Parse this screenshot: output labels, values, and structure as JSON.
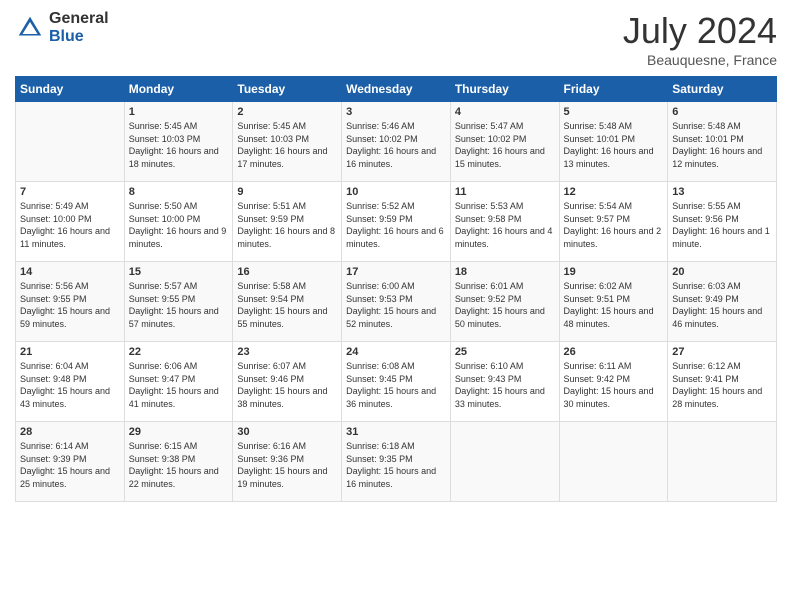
{
  "header": {
    "logo_general": "General",
    "logo_blue": "Blue",
    "month": "July 2024",
    "location": "Beauquesne, France"
  },
  "days_of_week": [
    "Sunday",
    "Monday",
    "Tuesday",
    "Wednesday",
    "Thursday",
    "Friday",
    "Saturday"
  ],
  "weeks": [
    [
      {
        "day": "",
        "sunrise": "",
        "sunset": "",
        "daylight": ""
      },
      {
        "day": "1",
        "sunrise": "Sunrise: 5:45 AM",
        "sunset": "Sunset: 10:03 PM",
        "daylight": "Daylight: 16 hours and 18 minutes."
      },
      {
        "day": "2",
        "sunrise": "Sunrise: 5:45 AM",
        "sunset": "Sunset: 10:03 PM",
        "daylight": "Daylight: 16 hours and 17 minutes."
      },
      {
        "day": "3",
        "sunrise": "Sunrise: 5:46 AM",
        "sunset": "Sunset: 10:02 PM",
        "daylight": "Daylight: 16 hours and 16 minutes."
      },
      {
        "day": "4",
        "sunrise": "Sunrise: 5:47 AM",
        "sunset": "Sunset: 10:02 PM",
        "daylight": "Daylight: 16 hours and 15 minutes."
      },
      {
        "day": "5",
        "sunrise": "Sunrise: 5:48 AM",
        "sunset": "Sunset: 10:01 PM",
        "daylight": "Daylight: 16 hours and 13 minutes."
      },
      {
        "day": "6",
        "sunrise": "Sunrise: 5:48 AM",
        "sunset": "Sunset: 10:01 PM",
        "daylight": "Daylight: 16 hours and 12 minutes."
      }
    ],
    [
      {
        "day": "7",
        "sunrise": "Sunrise: 5:49 AM",
        "sunset": "Sunset: 10:00 PM",
        "daylight": "Daylight: 16 hours and 11 minutes."
      },
      {
        "day": "8",
        "sunrise": "Sunrise: 5:50 AM",
        "sunset": "Sunset: 10:00 PM",
        "daylight": "Daylight: 16 hours and 9 minutes."
      },
      {
        "day": "9",
        "sunrise": "Sunrise: 5:51 AM",
        "sunset": "Sunset: 9:59 PM",
        "daylight": "Daylight: 16 hours and 8 minutes."
      },
      {
        "day": "10",
        "sunrise": "Sunrise: 5:52 AM",
        "sunset": "Sunset: 9:59 PM",
        "daylight": "Daylight: 16 hours and 6 minutes."
      },
      {
        "day": "11",
        "sunrise": "Sunrise: 5:53 AM",
        "sunset": "Sunset: 9:58 PM",
        "daylight": "Daylight: 16 hours and 4 minutes."
      },
      {
        "day": "12",
        "sunrise": "Sunrise: 5:54 AM",
        "sunset": "Sunset: 9:57 PM",
        "daylight": "Daylight: 16 hours and 2 minutes."
      },
      {
        "day": "13",
        "sunrise": "Sunrise: 5:55 AM",
        "sunset": "Sunset: 9:56 PM",
        "daylight": "Daylight: 16 hours and 1 minute."
      }
    ],
    [
      {
        "day": "14",
        "sunrise": "Sunrise: 5:56 AM",
        "sunset": "Sunset: 9:55 PM",
        "daylight": "Daylight: 15 hours and 59 minutes."
      },
      {
        "day": "15",
        "sunrise": "Sunrise: 5:57 AM",
        "sunset": "Sunset: 9:55 PM",
        "daylight": "Daylight: 15 hours and 57 minutes."
      },
      {
        "day": "16",
        "sunrise": "Sunrise: 5:58 AM",
        "sunset": "Sunset: 9:54 PM",
        "daylight": "Daylight: 15 hours and 55 minutes."
      },
      {
        "day": "17",
        "sunrise": "Sunrise: 6:00 AM",
        "sunset": "Sunset: 9:53 PM",
        "daylight": "Daylight: 15 hours and 52 minutes."
      },
      {
        "day": "18",
        "sunrise": "Sunrise: 6:01 AM",
        "sunset": "Sunset: 9:52 PM",
        "daylight": "Daylight: 15 hours and 50 minutes."
      },
      {
        "day": "19",
        "sunrise": "Sunrise: 6:02 AM",
        "sunset": "Sunset: 9:51 PM",
        "daylight": "Daylight: 15 hours and 48 minutes."
      },
      {
        "day": "20",
        "sunrise": "Sunrise: 6:03 AM",
        "sunset": "Sunset: 9:49 PM",
        "daylight": "Daylight: 15 hours and 46 minutes."
      }
    ],
    [
      {
        "day": "21",
        "sunrise": "Sunrise: 6:04 AM",
        "sunset": "Sunset: 9:48 PM",
        "daylight": "Daylight: 15 hours and 43 minutes."
      },
      {
        "day": "22",
        "sunrise": "Sunrise: 6:06 AM",
        "sunset": "Sunset: 9:47 PM",
        "daylight": "Daylight: 15 hours and 41 minutes."
      },
      {
        "day": "23",
        "sunrise": "Sunrise: 6:07 AM",
        "sunset": "Sunset: 9:46 PM",
        "daylight": "Daylight: 15 hours and 38 minutes."
      },
      {
        "day": "24",
        "sunrise": "Sunrise: 6:08 AM",
        "sunset": "Sunset: 9:45 PM",
        "daylight": "Daylight: 15 hours and 36 minutes."
      },
      {
        "day": "25",
        "sunrise": "Sunrise: 6:10 AM",
        "sunset": "Sunset: 9:43 PM",
        "daylight": "Daylight: 15 hours and 33 minutes."
      },
      {
        "day": "26",
        "sunrise": "Sunrise: 6:11 AM",
        "sunset": "Sunset: 9:42 PM",
        "daylight": "Daylight: 15 hours and 30 minutes."
      },
      {
        "day": "27",
        "sunrise": "Sunrise: 6:12 AM",
        "sunset": "Sunset: 9:41 PM",
        "daylight": "Daylight: 15 hours and 28 minutes."
      }
    ],
    [
      {
        "day": "28",
        "sunrise": "Sunrise: 6:14 AM",
        "sunset": "Sunset: 9:39 PM",
        "daylight": "Daylight: 15 hours and 25 minutes."
      },
      {
        "day": "29",
        "sunrise": "Sunrise: 6:15 AM",
        "sunset": "Sunset: 9:38 PM",
        "daylight": "Daylight: 15 hours and 22 minutes."
      },
      {
        "day": "30",
        "sunrise": "Sunrise: 6:16 AM",
        "sunset": "Sunset: 9:36 PM",
        "daylight": "Daylight: 15 hours and 19 minutes."
      },
      {
        "day": "31",
        "sunrise": "Sunrise: 6:18 AM",
        "sunset": "Sunset: 9:35 PM",
        "daylight": "Daylight: 15 hours and 16 minutes."
      },
      {
        "day": "",
        "sunrise": "",
        "sunset": "",
        "daylight": ""
      },
      {
        "day": "",
        "sunrise": "",
        "sunset": "",
        "daylight": ""
      },
      {
        "day": "",
        "sunrise": "",
        "sunset": "",
        "daylight": ""
      }
    ]
  ]
}
